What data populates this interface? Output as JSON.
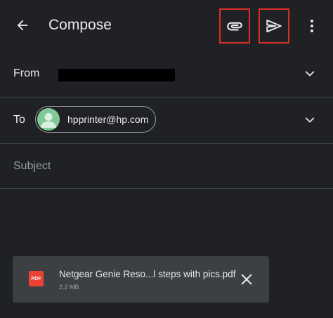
{
  "header": {
    "title": "Compose"
  },
  "icons": {
    "back": "arrow-back-icon",
    "attach": "paperclip-icon",
    "send": "send-icon",
    "more": "more-vert-icon",
    "expand": "chevron-down-icon",
    "close": "close-icon",
    "file": "pdf-icon"
  },
  "from": {
    "label": "From"
  },
  "to": {
    "label": "To",
    "recipient": "hpprinter@hp.com"
  },
  "subject": {
    "placeholder": "Subject",
    "value": ""
  },
  "attachment": {
    "type_label": "PDF",
    "name": "Netgear Genie Reso...l steps with pics.pdf",
    "size": "2.2 MB"
  },
  "colors": {
    "background": "#202124",
    "text": "#e8eaed",
    "divider": "#3c4043",
    "highlight": "#d93025",
    "avatar": "#81c995",
    "pdf": "#ea4335",
    "card": "#3c4043"
  }
}
